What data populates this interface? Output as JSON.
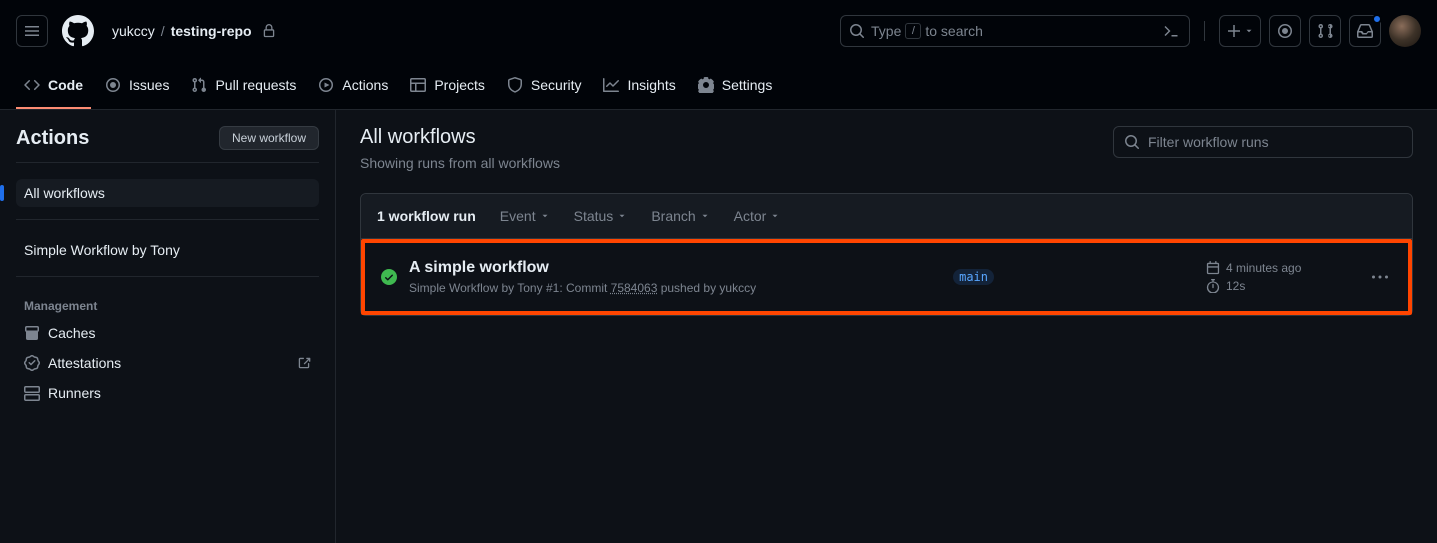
{
  "header": {
    "owner": "yukccy",
    "repo": "testing-repo",
    "search_prefix": "Type",
    "search_key": "/",
    "search_suffix": "to search"
  },
  "nav": {
    "code": "Code",
    "issues": "Issues",
    "pulls": "Pull requests",
    "actions": "Actions",
    "projects": "Projects",
    "security": "Security",
    "insights": "Insights",
    "settings": "Settings"
  },
  "sidebar": {
    "title": "Actions",
    "new_workflow": "New workflow",
    "all_workflows": "All workflows",
    "workflows": [
      {
        "name": "Simple Workflow by Tony"
      }
    ],
    "management_label": "Management",
    "mgmt": {
      "caches": "Caches",
      "attestations": "Attestations",
      "runners": "Runners"
    }
  },
  "main": {
    "title": "All workflows",
    "subtitle": "Showing runs from all workflows",
    "filter_placeholder": "Filter workflow runs",
    "run_count_label": "1 workflow run",
    "filters": {
      "event": "Event",
      "status": "Status",
      "branch": "Branch",
      "actor": "Actor"
    },
    "run": {
      "title": "A simple workflow",
      "wf_name": "Simple Workflow by Tony",
      "run_number": "#1",
      "desc_prefix": ": Commit ",
      "sha": "7584063",
      "desc_mid": " pushed by ",
      "actor": "yukccy",
      "branch": "main",
      "time": "4 minutes ago",
      "duration": "12s"
    }
  }
}
